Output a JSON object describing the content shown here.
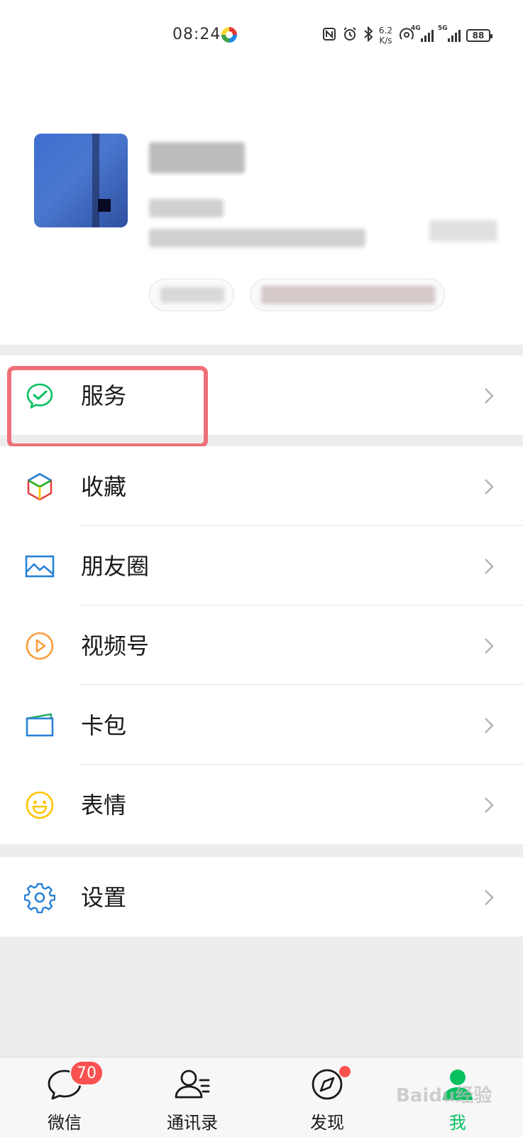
{
  "status_bar": {
    "time": "08:24",
    "speed_value": "6.2",
    "speed_unit": "K/s",
    "sig1_label": "4G",
    "sig2_label": "5G",
    "battery": "88"
  },
  "menu": {
    "service": "服务",
    "favorites": "收藏",
    "moments": "朋友圈",
    "channels": "视频号",
    "cards": "卡包",
    "stickers": "表情",
    "settings": "设置"
  },
  "tabs": {
    "chats": "微信",
    "chats_badge": "70",
    "contacts": "通讯录",
    "discover": "发现",
    "me": "我"
  },
  "colors": {
    "accent": "#07c160",
    "highlight": "#ef7078",
    "badge": "#fa5151"
  },
  "watermark": "Baidu经验"
}
